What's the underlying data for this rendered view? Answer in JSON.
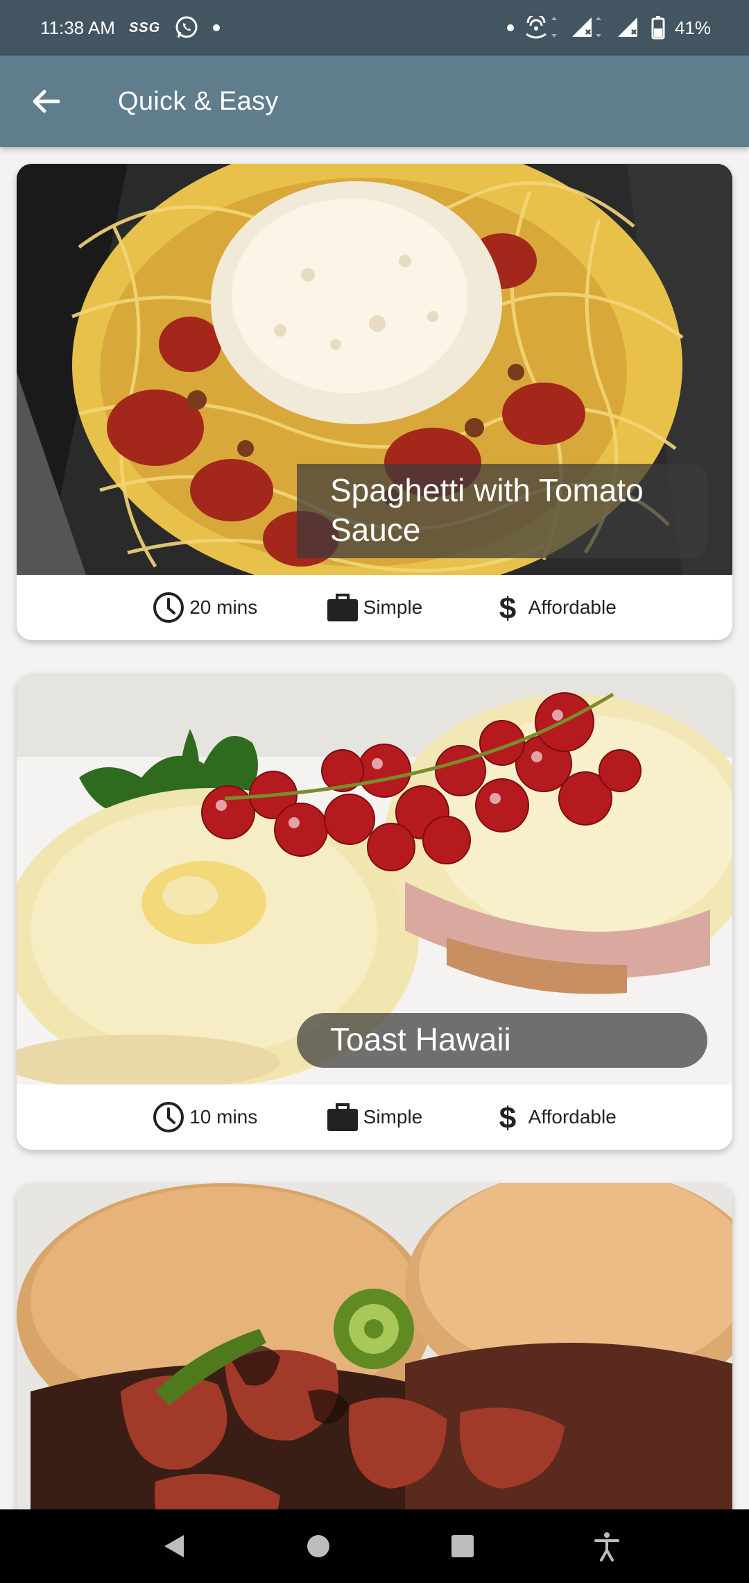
{
  "status_bar": {
    "time": "11:38 AM",
    "carrier_badge": "SSG",
    "battery": "41%",
    "icons": [
      "whatsapp-icon",
      "notification-dot-icon",
      "hotspot-icon",
      "signal-icon",
      "signal-icon",
      "battery-icon"
    ]
  },
  "app_bar": {
    "title": "Quick & Easy",
    "back_icon": "arrow-back-icon"
  },
  "meals": [
    {
      "title": "Spaghetti with Tomato Sauce",
      "duration": "20 mins",
      "complexity": "Simple",
      "affordability": "Affordable",
      "image": "spaghetti-photo"
    },
    {
      "title": "Toast Hawaii",
      "duration": "10 mins",
      "complexity": "Simple",
      "affordability": "Affordable",
      "image": "toast-hawaii-photo"
    },
    {
      "title": "",
      "image": "burger-photo"
    }
  ],
  "nav_bar": {
    "icons": [
      "back-triangle-icon",
      "home-circle-icon",
      "recents-square-icon",
      "accessibility-icon"
    ]
  },
  "colors": {
    "status_bar": "#435561",
    "app_bar": "#5f7d8c",
    "background": "#f3f3f3"
  }
}
